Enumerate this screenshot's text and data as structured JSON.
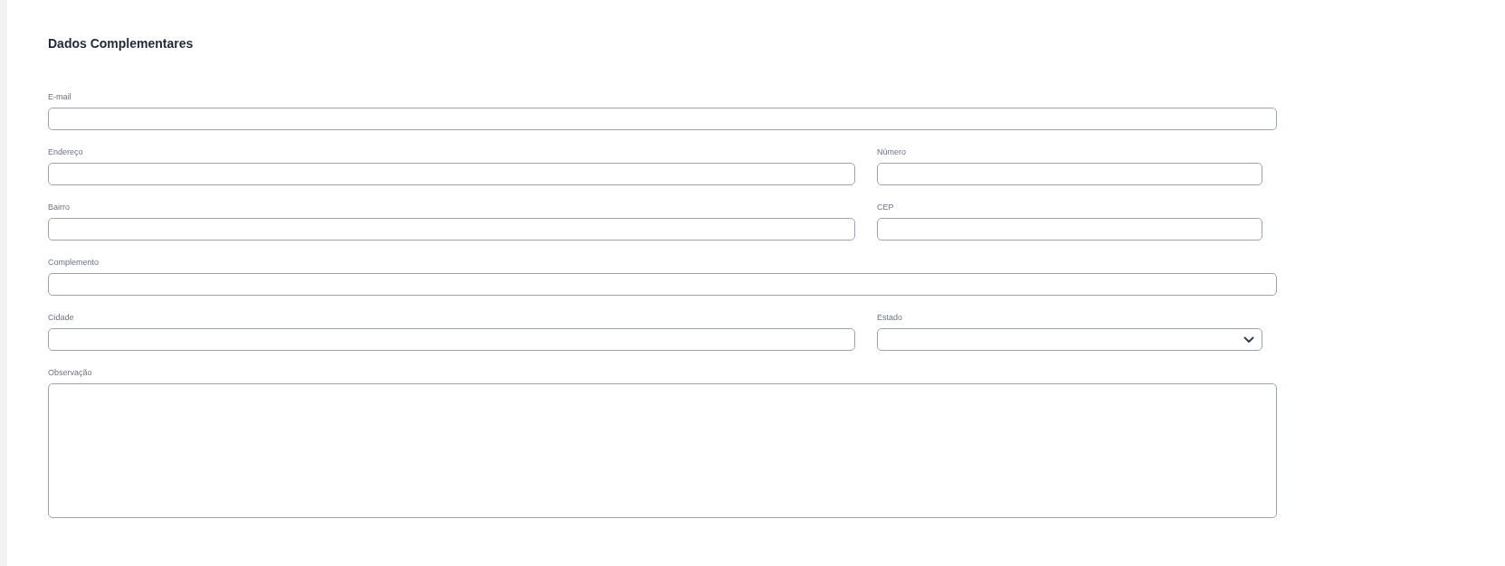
{
  "section": {
    "title": "Dados Complementares"
  },
  "rows": [
    [
      {
        "label": "E-mail",
        "kind": "text"
      }
    ],
    [
      {
        "label": "Endereço",
        "kind": "text"
      },
      {
        "label": "Número",
        "kind": "text"
      }
    ],
    [
      {
        "label": "Bairro",
        "kind": "text"
      },
      {
        "label": "CEP",
        "kind": "text"
      }
    ],
    [
      {
        "label": "Complemento",
        "kind": "text"
      }
    ],
    [
      {
        "label": "Cidade",
        "kind": "text"
      },
      {
        "label": "Estado",
        "kind": "select"
      }
    ],
    [
      {
        "label": "Observação",
        "kind": "textarea"
      }
    ]
  ]
}
